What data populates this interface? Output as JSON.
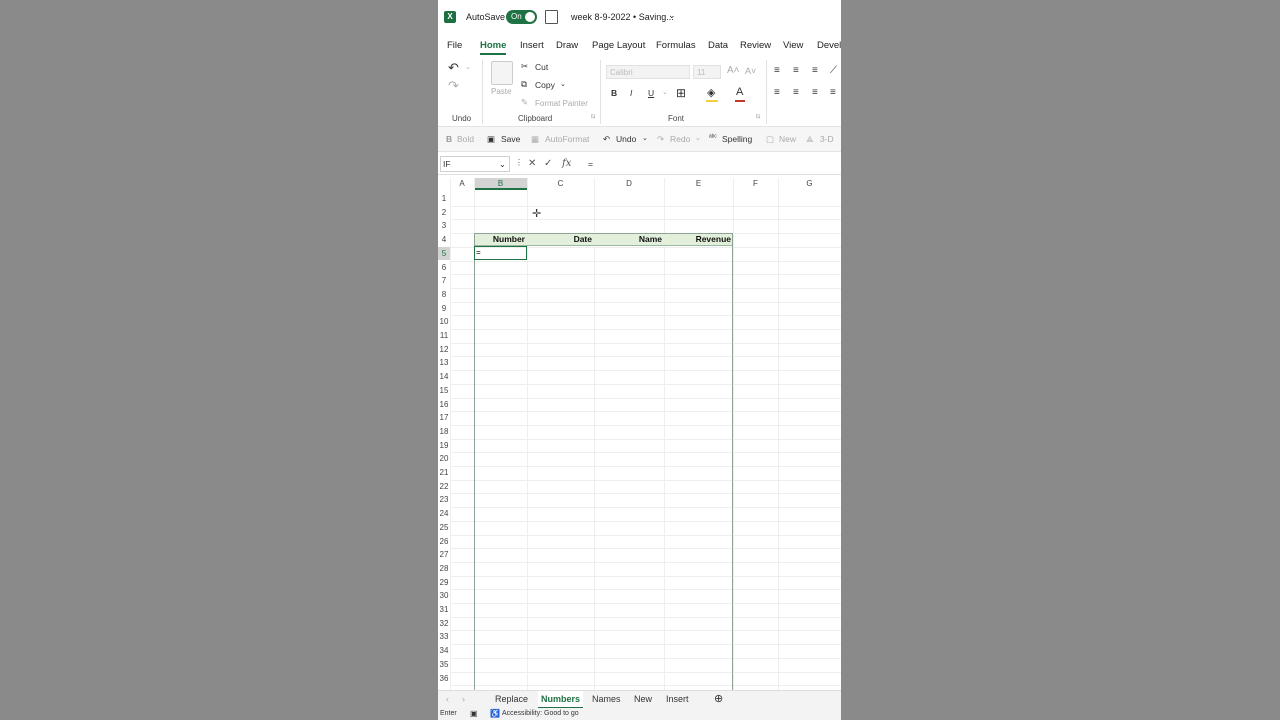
{
  "title_bar": {
    "logo": "X",
    "autosave_label": "AutoSave",
    "autosave_state": "On",
    "file_title": "week 8-9-2022 • Saving...",
    "chevron": "⌄"
  },
  "ribbon_tabs": [
    "File",
    "Home",
    "Insert",
    "Draw",
    "Page Layout",
    "Formulas",
    "Data",
    "Review",
    "View",
    "Develo"
  ],
  "active_tab": "Home",
  "ribbon": {
    "undo_group_label": "Undo",
    "paste_label": "Paste",
    "cut_label": "Cut",
    "copy_label": "Copy",
    "format_painter_label": "Format Painter",
    "clipboard_group_label": "Clipboard",
    "font_name": "Calibri",
    "font_size": "11",
    "font_group_label": "Font",
    "bold": "B",
    "italic": "I",
    "underline": "U"
  },
  "quick_access": {
    "bold": "Bold",
    "save": "Save",
    "autoformat": "AutoFormat",
    "undo": "Undo",
    "redo": "Redo",
    "spelling": "Spelling",
    "new": "New",
    "threed": "3-D"
  },
  "formula_bar": {
    "name_box": "IF",
    "formula": "="
  },
  "columns": [
    "A",
    "B",
    "C",
    "D",
    "E",
    "F",
    "G"
  ],
  "selected_column": "B",
  "rows": [
    "1",
    "2",
    "3",
    "4",
    "5",
    "6",
    "7",
    "8",
    "9",
    "10",
    "11",
    "12",
    "13",
    "14",
    "15",
    "16",
    "17",
    "18",
    "19",
    "20",
    "21",
    "22",
    "23",
    "24",
    "25",
    "26",
    "27",
    "28",
    "29",
    "30",
    "31",
    "32",
    "33",
    "34",
    "35",
    "36"
  ],
  "selected_row": "5",
  "table_headers": [
    "Number",
    "Date",
    "Name",
    "Revenue"
  ],
  "active_cell_value": "=",
  "sheet_tabs": [
    "Replace",
    "Numbers",
    "Names",
    "New",
    "Insert"
  ],
  "active_sheet": "Numbers",
  "status_bar": {
    "mode": "Enter",
    "accessibility": "Accessibility: Good to go"
  }
}
